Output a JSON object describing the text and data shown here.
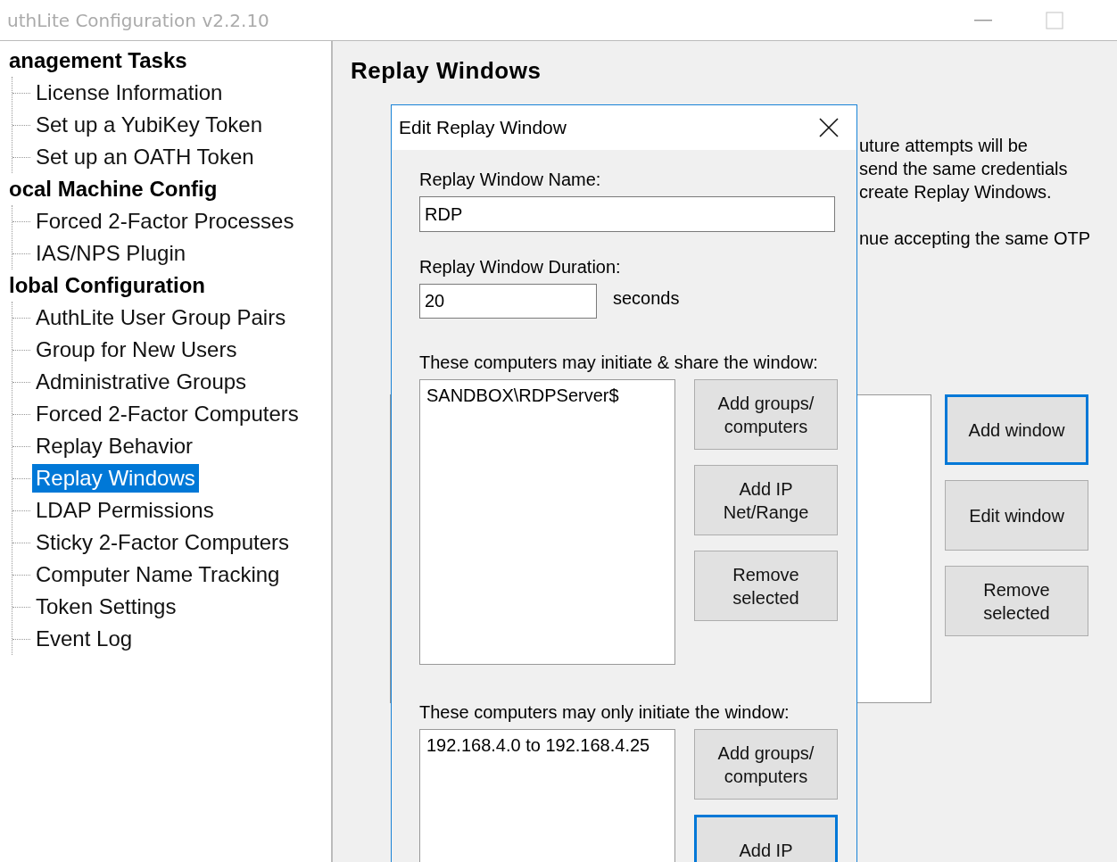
{
  "window": {
    "title": "uthLite Configuration  v2.2.10"
  },
  "tree": [
    {
      "label": "anagement Tasks",
      "selected": false,
      "children": [
        {
          "label": "License Information",
          "selected": false
        },
        {
          "label": "Set up a YubiKey Token",
          "selected": false
        },
        {
          "label": "Set up an OATH Token",
          "selected": false
        }
      ]
    },
    {
      "label": "ocal Machine Config",
      "selected": false,
      "children": [
        {
          "label": "Forced 2-Factor Processes",
          "selected": false
        },
        {
          "label": "IAS/NPS Plugin",
          "selected": false
        }
      ]
    },
    {
      "label": "lobal Configuration",
      "selected": false,
      "children": [
        {
          "label": "AuthLite User Group Pairs",
          "selected": false
        },
        {
          "label": "Group for New Users",
          "selected": false
        },
        {
          "label": "Administrative Groups",
          "selected": false
        },
        {
          "label": "Forced 2-Factor Computers",
          "selected": false
        },
        {
          "label": "Replay Behavior",
          "selected": false
        },
        {
          "label": "Replay Windows",
          "selected": true
        },
        {
          "label": "LDAP Permissions",
          "selected": false
        },
        {
          "label": "Sticky 2-Factor Computers",
          "selected": false
        },
        {
          "label": "Computer Name Tracking",
          "selected": false
        },
        {
          "label": "Token Settings",
          "selected": false
        },
        {
          "label": "Event Log",
          "selected": false
        }
      ]
    }
  ],
  "page": {
    "title": "Replay Windows",
    "description_lines": [
      "uture attempts will be",
      "send the same credentials",
      "create Replay Windows."
    ],
    "description_line_2": "nue accepting the same OTP",
    "buttons": [
      {
        "label": "Add window",
        "focused": true
      },
      {
        "label": "Edit window",
        "focused": false
      },
      {
        "label": "Remove selected",
        "focused": false
      }
    ]
  },
  "dialog": {
    "title": "Edit Replay Window",
    "name_label": "Replay Window Name:",
    "name_value": "RDP",
    "duration_label": "Replay Window Duration:",
    "duration_value": "20",
    "duration_unit": "seconds",
    "share_label": "These computers may initiate & share the window:",
    "share_list": [
      "SANDBOX\\RDPServer$"
    ],
    "share_buttons": [
      {
        "label": "Add groups/ computers",
        "focused": false
      },
      {
        "label": "Add IP Net/Range",
        "focused": false
      },
      {
        "label": "Remove selected",
        "focused": false
      }
    ],
    "initiate_label": "These computers may only initiate the window:",
    "initiate_list": [
      "192.168.4.0 to 192.168.4.25"
    ],
    "initiate_buttons": [
      {
        "label": "Add groups/ computers",
        "focused": false
      },
      {
        "label": "Add IP",
        "focused": true
      }
    ]
  }
}
